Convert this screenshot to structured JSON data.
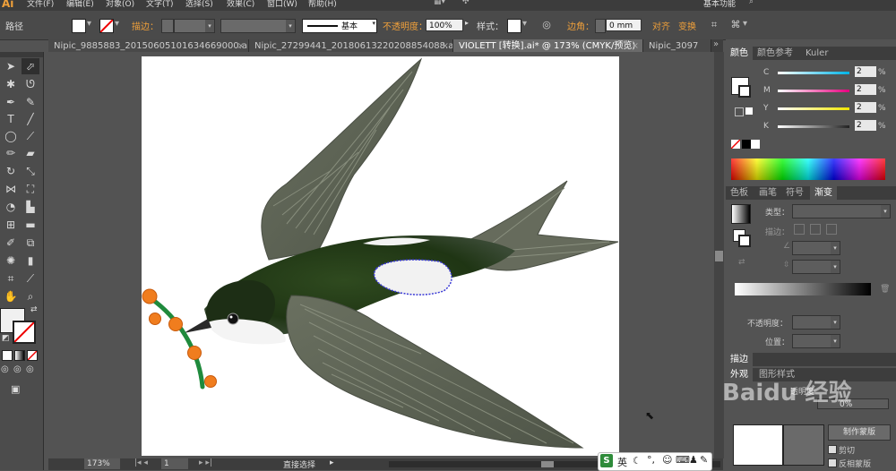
{
  "app": {
    "logo": "Ai"
  },
  "menu": [
    "文件(F)",
    "编辑(E)",
    "对象(O)",
    "文字(T)",
    "选择(S)",
    "效果(C)",
    "窗口(W)",
    "帮助(H)"
  ],
  "workspace": "基本功能",
  "control_bar": {
    "selection_label": "路径",
    "stroke_label": "描边：",
    "stroke_style": "基本",
    "opacity_label": "不透明度：",
    "opacity_value": "100%",
    "style_label": "样式：",
    "corner_label": "边角：",
    "corner_value": "0 mm",
    "align_label": "对齐",
    "transform_label": "变换"
  },
  "tabs": [
    {
      "label": "Nipic_9885883_20150605101634669000.ai*",
      "active": false
    },
    {
      "label": "Nipic_27299441_20180613220208854088.ai*",
      "active": false
    },
    {
      "label": "VIOLETT [转换].ai* @ 173% (CMYK/预览)",
      "active": true
    },
    {
      "label": "Nipic_3097",
      "active": false
    }
  ],
  "status_bar": {
    "zoom": "173%",
    "page": "1",
    "tool": "直接选择"
  },
  "color_panel": {
    "tabs": [
      "颜色",
      "颜色参考",
      "Kuler"
    ],
    "channels": [
      {
        "label": "C",
        "value": "2",
        "pct": "%",
        "color": "#00b4e6"
      },
      {
        "label": "M",
        "value": "2",
        "pct": "%",
        "color": "#e6007e"
      },
      {
        "label": "Y",
        "value": "2",
        "pct": "%",
        "color": "#f0e600"
      },
      {
        "label": "K",
        "value": "2",
        "pct": "%",
        "color": "#222222"
      }
    ]
  },
  "gradient_panel": {
    "tabs": [
      "色板",
      "画笔",
      "符号",
      "渐变"
    ],
    "type_label": "类型：",
    "stroke_label": "描边：",
    "opacity_label": "不透明度：",
    "position_label": "位置："
  },
  "stroke_panel": {
    "title": "描边"
  },
  "appearance_panel": {
    "tabs": [
      "外观",
      "图形样式"
    ],
    "opacity_label": "透明度",
    "opacity_value": "0%",
    "mask_button": "制作蒙版",
    "clip_label": "剪切",
    "invert_label": "反相蒙版"
  },
  "ime_bar": {
    "lang": "英"
  },
  "watermark": "Baidu 经验"
}
